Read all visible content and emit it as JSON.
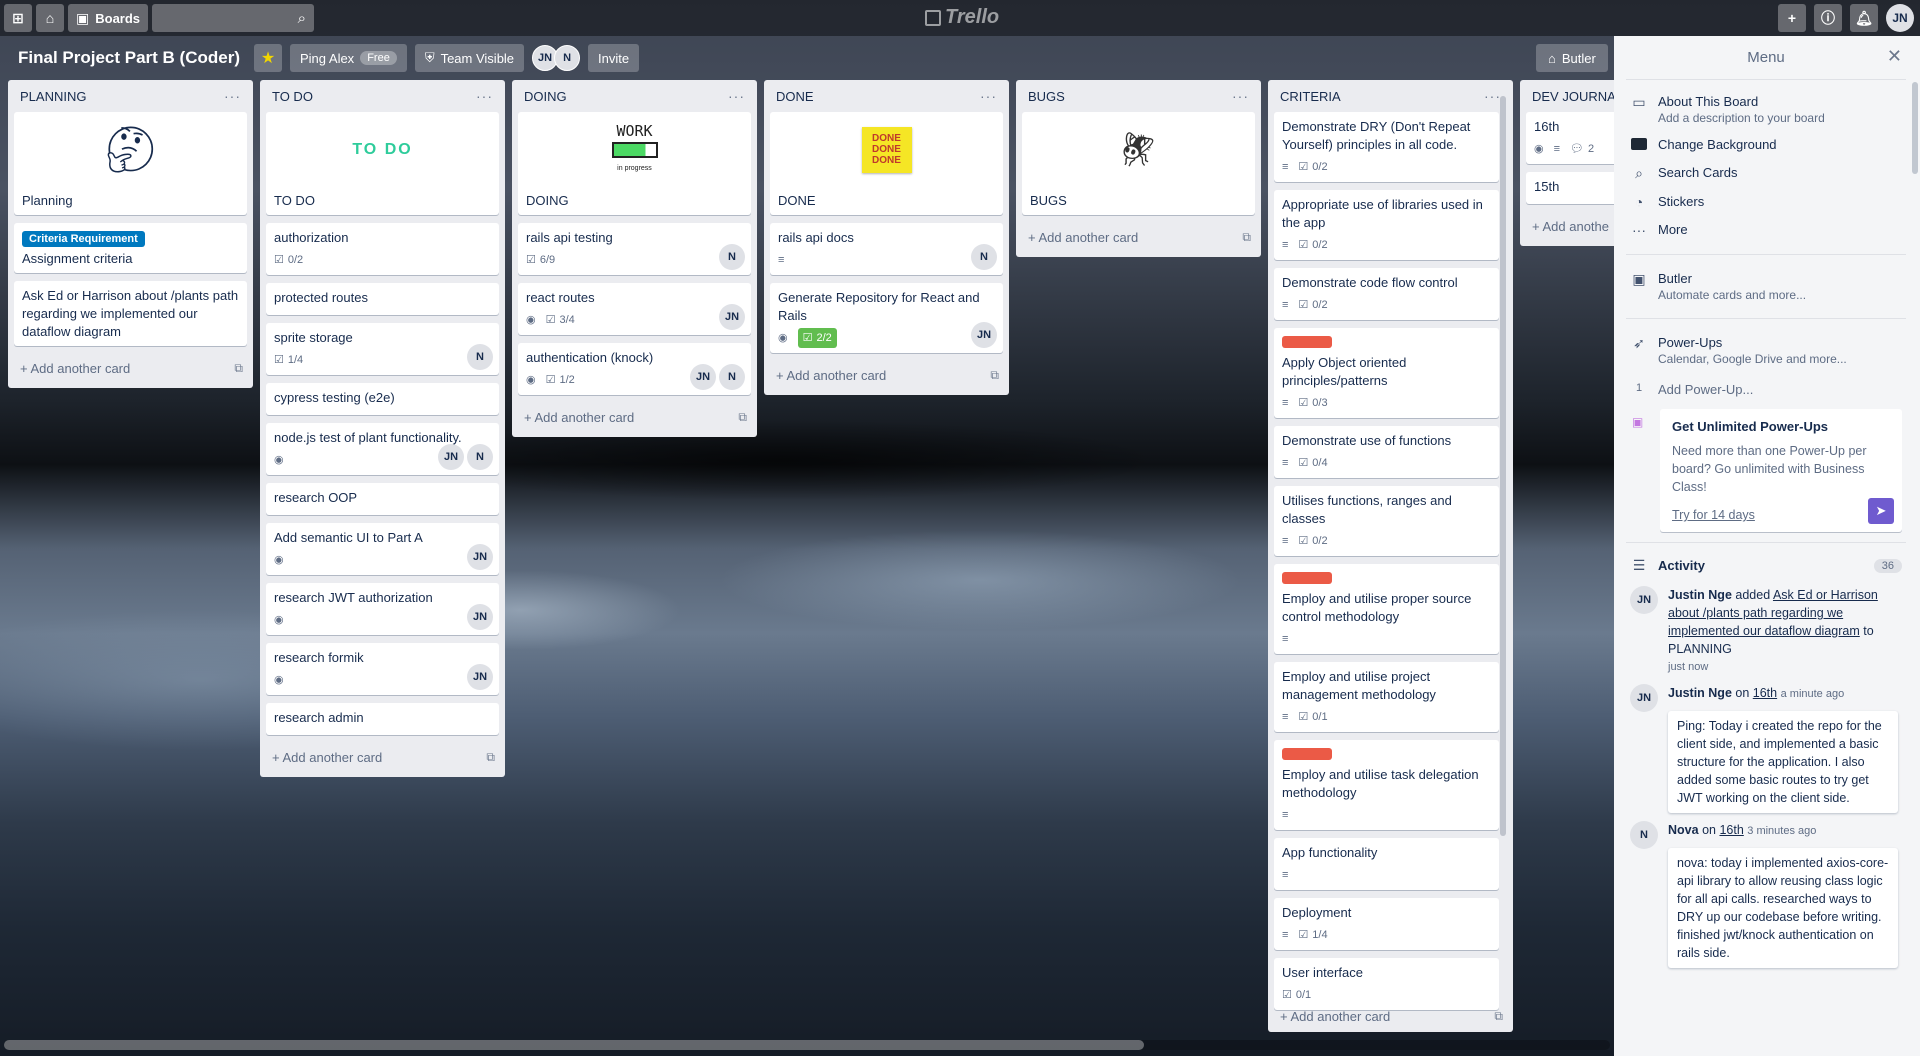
{
  "topbar": {
    "boards_label": "Boards",
    "logo": "Trello",
    "avatar": "JN"
  },
  "board": {
    "title": "Final Project Part B (Coder)",
    "ping_label": "Ping Alex",
    "ping_badge": "Free",
    "visibility": "Team Visible",
    "members": [
      "JN",
      "N"
    ],
    "invite": "Invite",
    "butler": "Butler"
  },
  "add_card_label": "Add another card",
  "lists": {
    "planning": {
      "title": "PLANNING",
      "cards": [
        {
          "cover": "thinking-face",
          "title": "Planning"
        },
        {
          "label": "Criteria Requirement",
          "title": "Assignment criteria"
        },
        {
          "title": "Ask Ed or Harrison about /plants path regarding we implemented our dataflow diagram"
        }
      ]
    },
    "todo": {
      "title": "TO DO",
      "cover_text": "TO DO",
      "cards": [
        {
          "title": "TO DO"
        },
        {
          "title": "authorization",
          "checklist": "0/2"
        },
        {
          "title": "protected routes"
        },
        {
          "title": "sprite storage",
          "checklist": "1/4",
          "members": [
            "N"
          ]
        },
        {
          "title": "cypress testing (e2e)"
        },
        {
          "title": "node.js test of plant functionality.",
          "members": [
            "JN",
            "N"
          ]
        },
        {
          "title": "research OOP"
        },
        {
          "title": "Add semantic UI to Part A",
          "members": [
            "JN"
          ]
        },
        {
          "title": "research JWT authorization",
          "members": [
            "JN"
          ]
        },
        {
          "title": "research formik",
          "members": [
            "JN"
          ]
        },
        {
          "title": "research admin"
        }
      ]
    },
    "doing": {
      "title": "DOING",
      "cover_text": "WORK",
      "cover_sub": "in progress",
      "cards": [
        {
          "title": "DOING"
        },
        {
          "title": "rails api testing",
          "checklist": "6/9",
          "members": [
            "N"
          ]
        },
        {
          "title": "react routes",
          "checklist": "3/4",
          "members": [
            "JN"
          ]
        },
        {
          "title": "authentication (knock)",
          "checklist": "1/2",
          "members": [
            "JN",
            "N"
          ]
        }
      ]
    },
    "done": {
      "title": "DONE",
      "cover_text": "DONE DONE DONE",
      "cards": [
        {
          "title": "DONE"
        },
        {
          "title": "rails api docs",
          "members": [
            "N"
          ]
        },
        {
          "title": "Generate Repository for React and Rails",
          "checklist": "2/2",
          "members": [
            "JN"
          ]
        }
      ]
    },
    "bugs": {
      "title": "BUGS",
      "cards": [
        {
          "title": "BUGS"
        }
      ]
    },
    "criteria": {
      "title": "CRITERIA",
      "cards": [
        {
          "title": "Demonstrate DRY (Don't Repeat Yourself) principles in all code.",
          "checklist": "0/2"
        },
        {
          "title": "Appropriate use of libraries used in the app",
          "checklist": "0/2"
        },
        {
          "title": "Demonstrate code flow control",
          "checklist": "0/2"
        },
        {
          "title": "Apply Object oriented principles/patterns",
          "checklist": "0/3"
        },
        {
          "title": "Demonstrate use of functions",
          "checklist": "0/4"
        },
        {
          "title": "Utilises functions, ranges and classes",
          "checklist": "0/2"
        },
        {
          "title": "Employ and utilise proper source control methodology"
        },
        {
          "title": "Employ and utilise project management methodology",
          "checklist": "0/1"
        },
        {
          "title": "Employ and utilise task delegation methodology"
        },
        {
          "title": "App functionality"
        },
        {
          "title": "Deployment",
          "checklist": "1/4"
        },
        {
          "title": "User interface",
          "checklist": "0/1"
        }
      ]
    },
    "devjournal": {
      "title": "DEV JOURNAL",
      "cards": [
        {
          "title": "16th",
          "comments": "2"
        },
        {
          "title": "15th"
        }
      ],
      "add_label": "Add anothe"
    }
  },
  "menu": {
    "title": "Menu",
    "about_title": "About This Board",
    "about_sub": "Add a description to your board",
    "change_bg": "Change Background",
    "search_cards": "Search Cards",
    "stickers": "Stickers",
    "more": "More",
    "butler_title": "Butler",
    "butler_sub": "Automate cards and more...",
    "powerups_title": "Power-Ups",
    "powerups_sub": "Calendar, Google Drive and more...",
    "powerups_count": "1",
    "add_powerup": "Add Power-Up...",
    "unlimited_title": "Get Unlimited Power-Ups",
    "unlimited_text": "Need more than one Power-Up per board? Go unlimited with Business Class!",
    "trial_link": "Try for 14 days",
    "activity_title": "Activity",
    "activity_count": "36",
    "activity": [
      {
        "avatar": "JN",
        "user": "Justin Nge",
        "verb": "added",
        "link": "Ask Ed or Harrison about /plants path regarding we implemented our dataflow diagram",
        "rest": "to PLANNING",
        "time": "just now"
      },
      {
        "avatar": "JN",
        "user": "Justin Nge",
        "verb": "on",
        "link": "16th",
        "time": "a minute ago",
        "comment": "Ping: Today i created the repo for the client side, and implemented a basic structure for the application. I also added some basic routes to try get JWT working on the client side."
      },
      {
        "avatar": "N",
        "user": "Nova",
        "verb": "on",
        "link": "16th",
        "time": "3 minutes ago",
        "comment": "nova: today i implemented axios-core-api library to allow reusing class logic for all api calls. researched ways to DRY up our codebase before writing. finished jwt/knock authentication on rails side."
      }
    ]
  },
  "colors": {
    "label_blue": "#0079bf",
    "label_red": "#eb5a46",
    "checklist_done": "#61bd4f",
    "menu_bg": "#f4f5f7",
    "list_bg": "#ebecf0"
  }
}
